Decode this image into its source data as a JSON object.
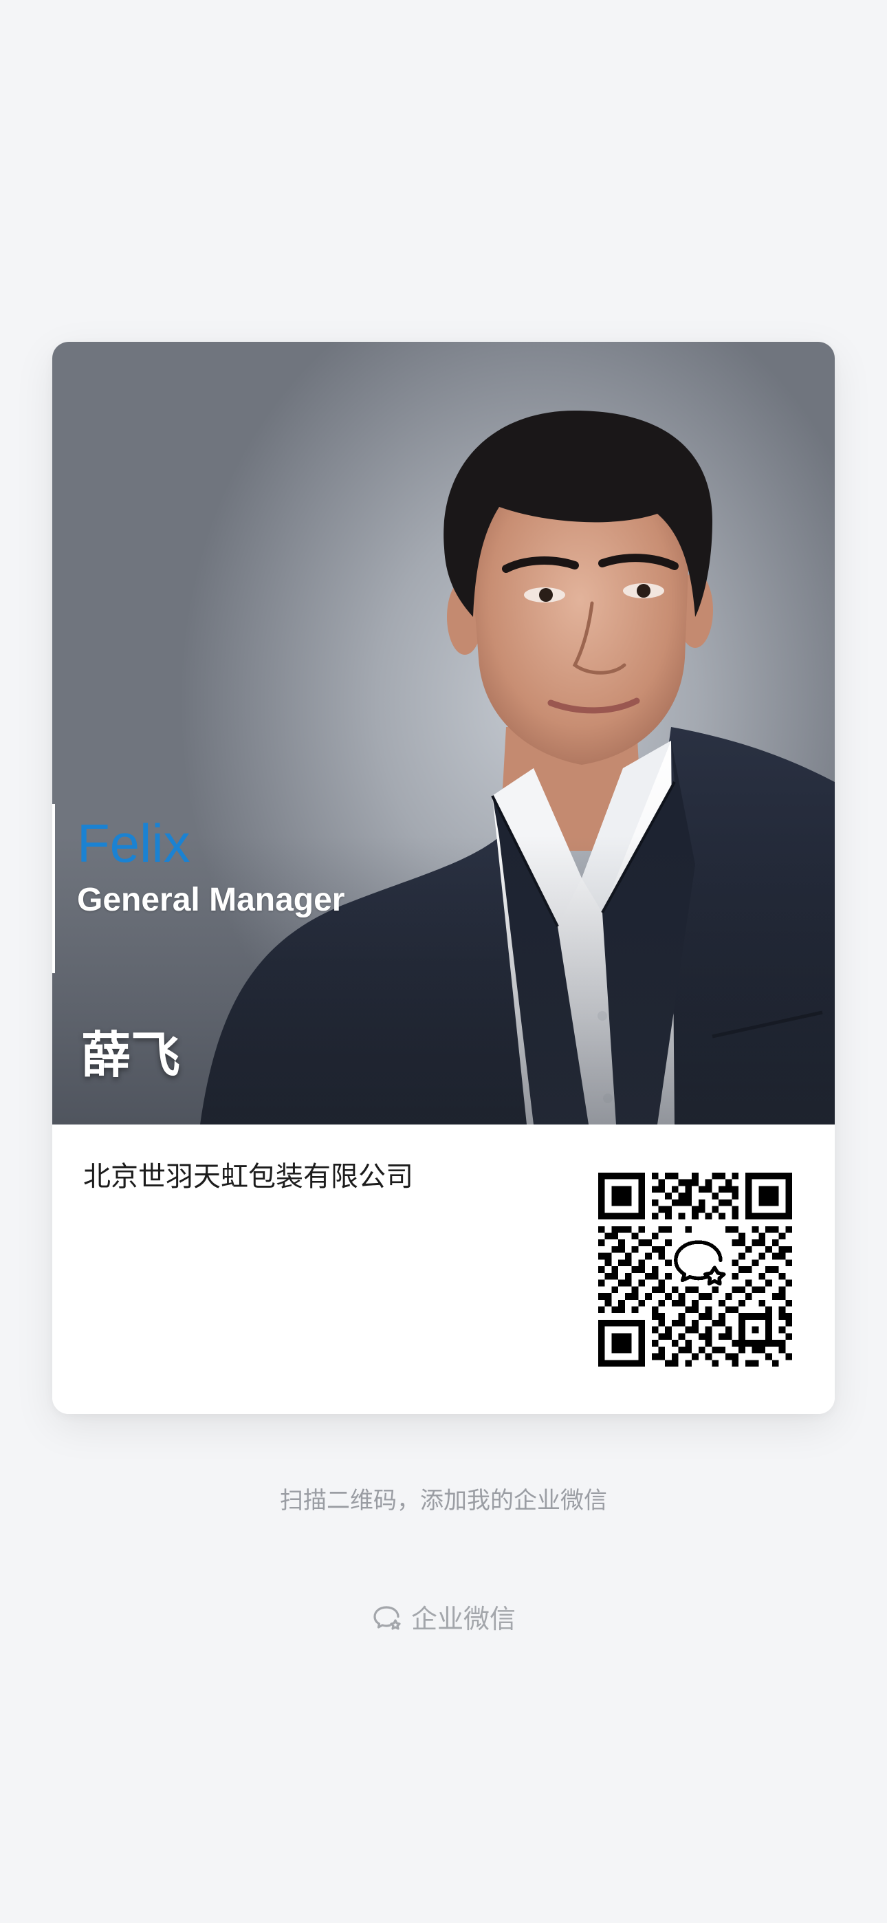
{
  "card": {
    "name_en": "Felix",
    "title": "General Manager",
    "name_cn": "薛飞",
    "company": "北京世羽天虹包装有限公司",
    "accent_color": "#1b82d2"
  },
  "footer": {
    "scan_hint": "扫描二维码，添加我的企业微信",
    "brand_label": "企业微信",
    "brand_icon": "wecom-logo-icon"
  }
}
